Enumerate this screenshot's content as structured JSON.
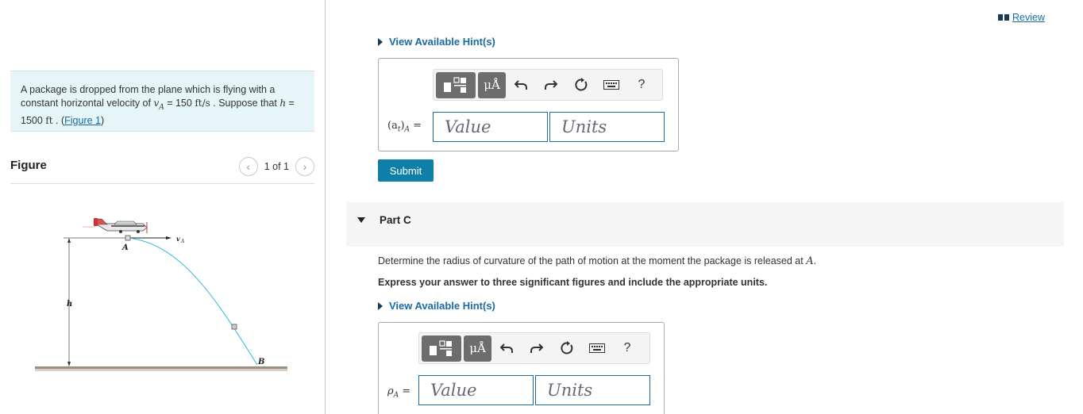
{
  "problem": {
    "text_before": "A package is dropped from the plane which is flying with a constant horizontal velocity of ",
    "var_vA": "v",
    "var_vA_sub": "A",
    "eq1": " = 150 ",
    "unit1": "ft/s",
    "text_mid": " . Suppose that ",
    "var_h": "h",
    "eq2": " = 1500 ",
    "unit2": "ft",
    "text_after": " . (",
    "figure_link": "Figure 1",
    "close": ")"
  },
  "figure": {
    "title": "Figure",
    "pager_text": "1 of 1",
    "prev_icon": "chevron-left-icon",
    "next_icon": "chevron-right-icon",
    "labels": {
      "A": "A",
      "B": "B",
      "h": "h",
      "vA": "v",
      "vA_sub": "A"
    }
  },
  "header": {
    "review_label": "Review",
    "review_icon": "book-icon"
  },
  "part_b": {
    "hint_label": "View Available Hint(s)",
    "input_label_main": "(a",
    "input_label_sub_t": "t",
    "input_label_close": ")",
    "input_label_sub": "A",
    "input_label_eq": " =",
    "value_placeholder": "Value",
    "units_placeholder": "Units",
    "submit_label": "Submit"
  },
  "part_c": {
    "title": "Part C",
    "question": "Determine the radius of curvature of the path of motion at the moment the package is released at ",
    "question_var": "A",
    "question_end": ".",
    "instruction": "Express your answer to three significant figures and include the appropriate units.",
    "hint_label": "View Available Hint(s)",
    "input_label_main": "ρ",
    "input_label_sub": "A",
    "input_label_eq": " =",
    "value_placeholder": "Value",
    "units_placeholder": "Units"
  },
  "toolbar": {
    "mu_label": "μÅ",
    "help_label": "?",
    "icons": [
      "template-icon",
      "units-icon",
      "undo-icon",
      "redo-icon",
      "reset-icon",
      "keyboard-icon",
      "help-icon"
    ]
  },
  "colors": {
    "accent": "#1a6aa5",
    "submit": "#0f7fa8",
    "problem_bg": "#e6f6f8",
    "trajectory": "#3ab7e0"
  }
}
